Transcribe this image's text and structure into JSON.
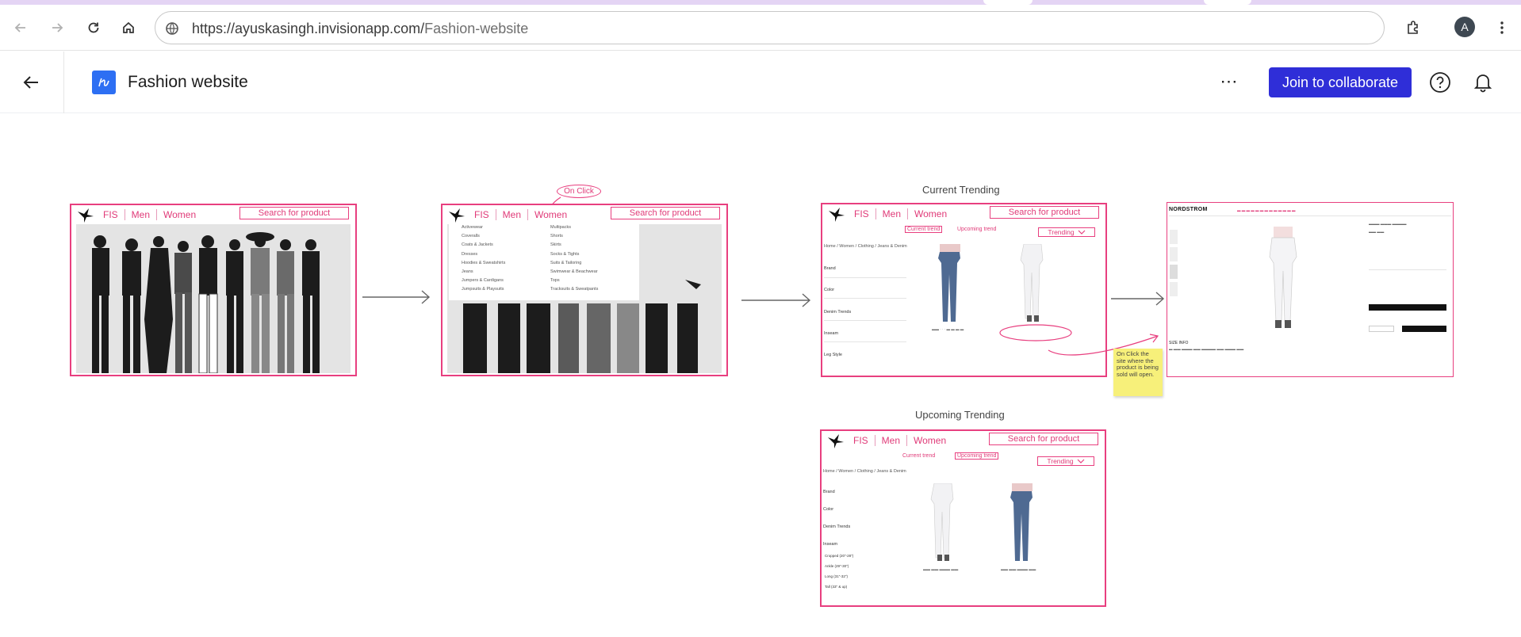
{
  "browser": {
    "url_host": "https://ayuskasingh.invisionapp.com/",
    "url_path": "Fashion-website",
    "avatar_letter": "A"
  },
  "app": {
    "title": "Fashion website",
    "join_label": "Join to collaborate",
    "more_label": "⋯",
    "accent": "#2f2ed8",
    "logo_color": "#2d6ff3"
  },
  "wire": {
    "accent": "#e83f7f",
    "brand": "FIS",
    "nav": [
      "Men",
      "Women"
    ],
    "search": "Search for product",
    "on_click": "On Click",
    "menu_col1": [
      "Activewear",
      "Coveralls",
      "Coats & Jackets",
      "Dresses",
      "Hoodies & Sweatshirts",
      "Jeans",
      "Jumpers & Cardigans",
      "Jumpsuits & Playsuits"
    ],
    "menu_col2": [
      "Multipacks",
      "Shorts",
      "Skirts",
      "Socks & Tights",
      "Suits & Tailoring",
      "Swimwear & Beachwear",
      "Tops",
      "Tracksuits & Sweatpants"
    ],
    "current_label": "Current Trending",
    "upcoming_label": "Upcoming Trending",
    "tab_current": "Current trend",
    "tab_upcoming": "Upcoming trend",
    "dropdown": "Trending",
    "breadcrumb": "Home  /  Women  /  Clothing  /  Jeans & Denim",
    "filters": [
      "Brand",
      "Color",
      "Denim Trends",
      "Inseam",
      "Leg Style"
    ],
    "filters_upcoming": [
      "Brand",
      "Color",
      "Denim Trends",
      "Inseam"
    ],
    "inseam_options": [
      "Cropped (20\"-28\")",
      "Ankle (29\"-30\")",
      "Long (31\"-32\")",
      "Tall (33\" & up)"
    ],
    "note": "On Click the site where the product is being sold will open.",
    "nordstrom": "NORDSTROM",
    "size_info": "SIZE INFO"
  }
}
